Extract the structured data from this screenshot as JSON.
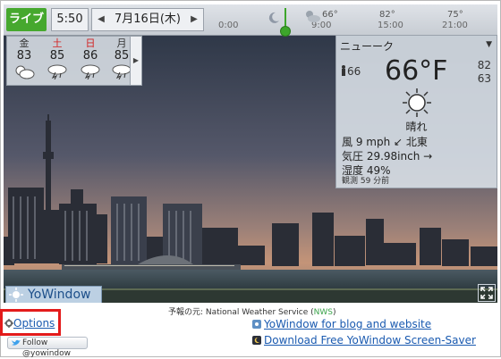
{
  "topbar": {
    "live_label": "ライブ",
    "time": "5:50",
    "date": "7月16日(木)",
    "date_prev": "◀",
    "date_next": "▶"
  },
  "timeline": {
    "times": [
      "0:00",
      "9:00",
      "15:00",
      "21:00"
    ],
    "temps": [
      "66°",
      "82°",
      "75°"
    ],
    "current_hour_fraction": 0.22
  },
  "forecast": {
    "days": [
      {
        "name": "金",
        "temp": "83",
        "icon": "partly-cloudy-icon",
        "weekend": false
      },
      {
        "name": "土",
        "temp": "85",
        "icon": "thunderstorm-icon",
        "weekend": true
      },
      {
        "name": "日",
        "temp": "86",
        "icon": "thunderstorm-icon",
        "weekend": true
      },
      {
        "name": "月",
        "temp": "85",
        "icon": "thunderstorm-icon",
        "weekend": false
      }
    ],
    "next": "▶"
  },
  "current": {
    "city": "ニューーク",
    "dropdown": "▼",
    "feels_like": "66",
    "temperature": "66°F",
    "high": "82",
    "low": "63",
    "condition": "晴れ",
    "wind": "風 9 mph ↙ 北東",
    "pressure": "気圧 29.98inch →",
    "humidity": "湿度 49%",
    "observed": "観測 59 分前"
  },
  "brand": {
    "name": "YoWindow"
  },
  "footer": {
    "source_prefix": "予報の元: National Weather Service (",
    "source_nws": "NWS",
    "source_suffix": ")",
    "options": "Options",
    "follow": "Follow @yowindow",
    "blog_link": "YoWindow for blog and website",
    "screensaver_link": "Download Free YoWindow Screen-Saver"
  },
  "colors": {
    "live": "#46a82e",
    "link": "#1a5ab0",
    "highlight": "#e31b1b"
  }
}
